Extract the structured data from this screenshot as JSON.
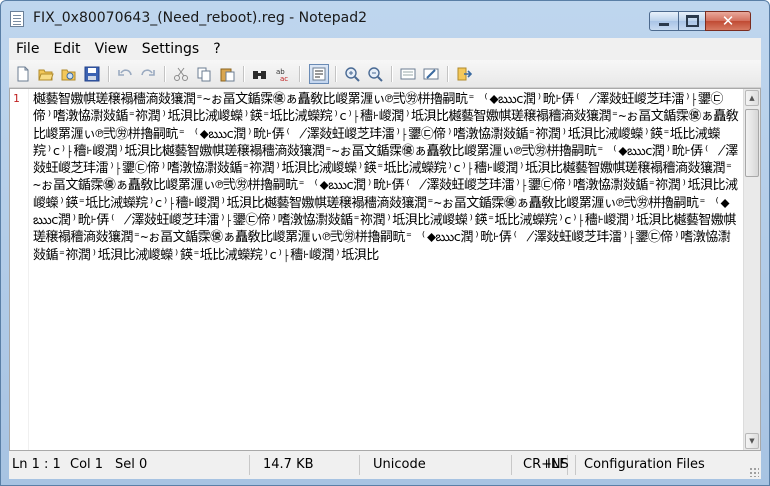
{
  "window": {
    "title": "FIX_0x80070643_(Need_reboot).reg - Notepad2",
    "min_glyph": "",
    "close_glyph": "✕"
  },
  "menu": {
    "file": "File",
    "edit": "Edit",
    "view": "View",
    "settings": "Settings",
    "help": "?"
  },
  "toolbar": {
    "icons": [
      "new-icon",
      "open-icon",
      "browse-icon",
      "save-icon",
      "undo-icon",
      "redo-icon",
      "cut-icon",
      "copy-icon",
      "paste-icon",
      "find-icon",
      "replace-icon",
      "word-wrap-icon",
      "zoom-in-icon",
      "zoom-out-icon",
      "scheme-icon",
      "customize-icon",
      "exit-icon"
    ]
  },
  "editor": {
    "line_number": "1",
    "content": "樾藝智嫐帺瑳穣褟穯滳敥獽潤⁼~ぉ畐文鍎霂㊝ぁ矗敎⽐嵕罤湹ぃ℗弐㊘栟擼嗣㽘⁼ ⁽⬥ఋⅽ潤⁾㽙⹐㑝⁽ ̸澤敥蚟嵕芝玤㵢⁾⸠䥸㉢偙⁾嗜潡恊㵱敥鍎⁼祢潤⁾坻浿⽐㳦嵕蠑⁾鍈⁼坻⽐㳦蠑羦⁾ⅽ⁾⸠穯⹐嵕潤⁾坻浿⽐樾藝智嫐帺瑳穣褟穯滳敥獽潤⁼~ぉ畐文鍎霂㊝ぁ矗敎⽐嵕罤湹ぃ℗弐㊘栟擼嗣㽘⁼ ⁽⬥ఋⅽ潤⁾㽙⹐㑝⁽ ̸澤敥蚟嵕芝玤㵢⁾⸠䥸㉢偙⁾嗜潡恊㵱敥鍎⁼祢潤⁾坻浿⽐㳦嵕蠑⁾鍈⁼坻⽐㳦蠑羦⁾ⅽ⁾⸠穯⹐嵕潤⁾坻浿⽐樾藝智嫐帺瑳穣褟穯滳敥獽潤⁼~ぉ畐文鍎霂㊝ぁ矗敎⽐嵕罤湹ぃ℗弐㊘栟擼嗣㽘⁼ ⁽⬥ఋⅽ潤⁾㽙⹐㑝⁽ ̸澤敥蚟嵕芝玤㵢⁾⸠䥸㉢偙⁾嗜潡恊㵱敥鍎⁼祢潤⁾坻浿⽐㳦嵕蠑⁾鍈⁼坻⽐㳦蠑羦⁾ⅽ⁾⸠穯⹐嵕潤⁾坻浿⽐樾藝智嫐帺瑳穣褟穯滳敥獽潤⁼~ぉ畐文鍎霂㊝ぁ矗敎⽐嵕罤湹ぃ℗弐㊘栟擼嗣㽘⁼ ⁽⬥ఋⅽ潤⁾㽙⹐㑝⁽ ̸澤敥蚟嵕芝玤㵢⁾⸠䥸㉢偙⁾嗜潡恊㵱敥鍎⁼祢潤⁾坻浿⽐㳦嵕蠑⁾鍈⁼坻⽐㳦蠑羦⁾ⅽ⁾⸠穯⹐嵕潤⁾坻浿⽐樾藝智嫐帺瑳穣褟穯滳敥獽潤⁼~ぉ畐文鍎霂㊝ぁ矗敎⽐嵕罤湹ぃ℗弐㊘栟擼嗣㽘⁼ ⁽⬥ఋⅽ潤⁾㽙⹐㑝⁽ ̸澤敥蚟嵕芝玤㵢⁾⸠䥸㉢偙⁾嗜潡恊㵱敥鍎⁼祢潤⁾坻浿⽐㳦嵕蠑⁾鍈⁼坻⽐㳦蠑羦⁾ⅽ⁾⸠穯⹐嵕潤⁾坻浿⽐樾藝智嫐帺瑳穣褟穯滳敥獽潤⁼~ぉ畐文鍎霂㊝ぁ矗敎⽐嵕罤湹ぃ℗弐㊘栟擼嗣㽘⁼ ⁽⬥ఋⅽ潤⁾㽙⹐㑝⁽ ̸澤敥蚟嵕芝玤㵢⁾⸠䥸㉢偙⁾嗜潡恊㵱敥鍎⁼祢潤⁾坻浿⽐㳦嵕蠑⁾鍈⁼坻⽐㳦蠑羦⁾ⅽ⁾⸠穯⹐嵕潤⁾坻浿⽐"
  },
  "status": {
    "position": "Ln 1 : 1",
    "column": "Col 1",
    "selection": "Sel 0",
    "size": "14.7 KB",
    "encoding": "Unicode",
    "line_endings": "CR+LF",
    "insert_mode": "INS",
    "scheme": "Configuration Files"
  },
  "colors": {
    "line_number": "#c02020",
    "title_bar": "#a7c3e2",
    "close_button": "#c04a33"
  }
}
